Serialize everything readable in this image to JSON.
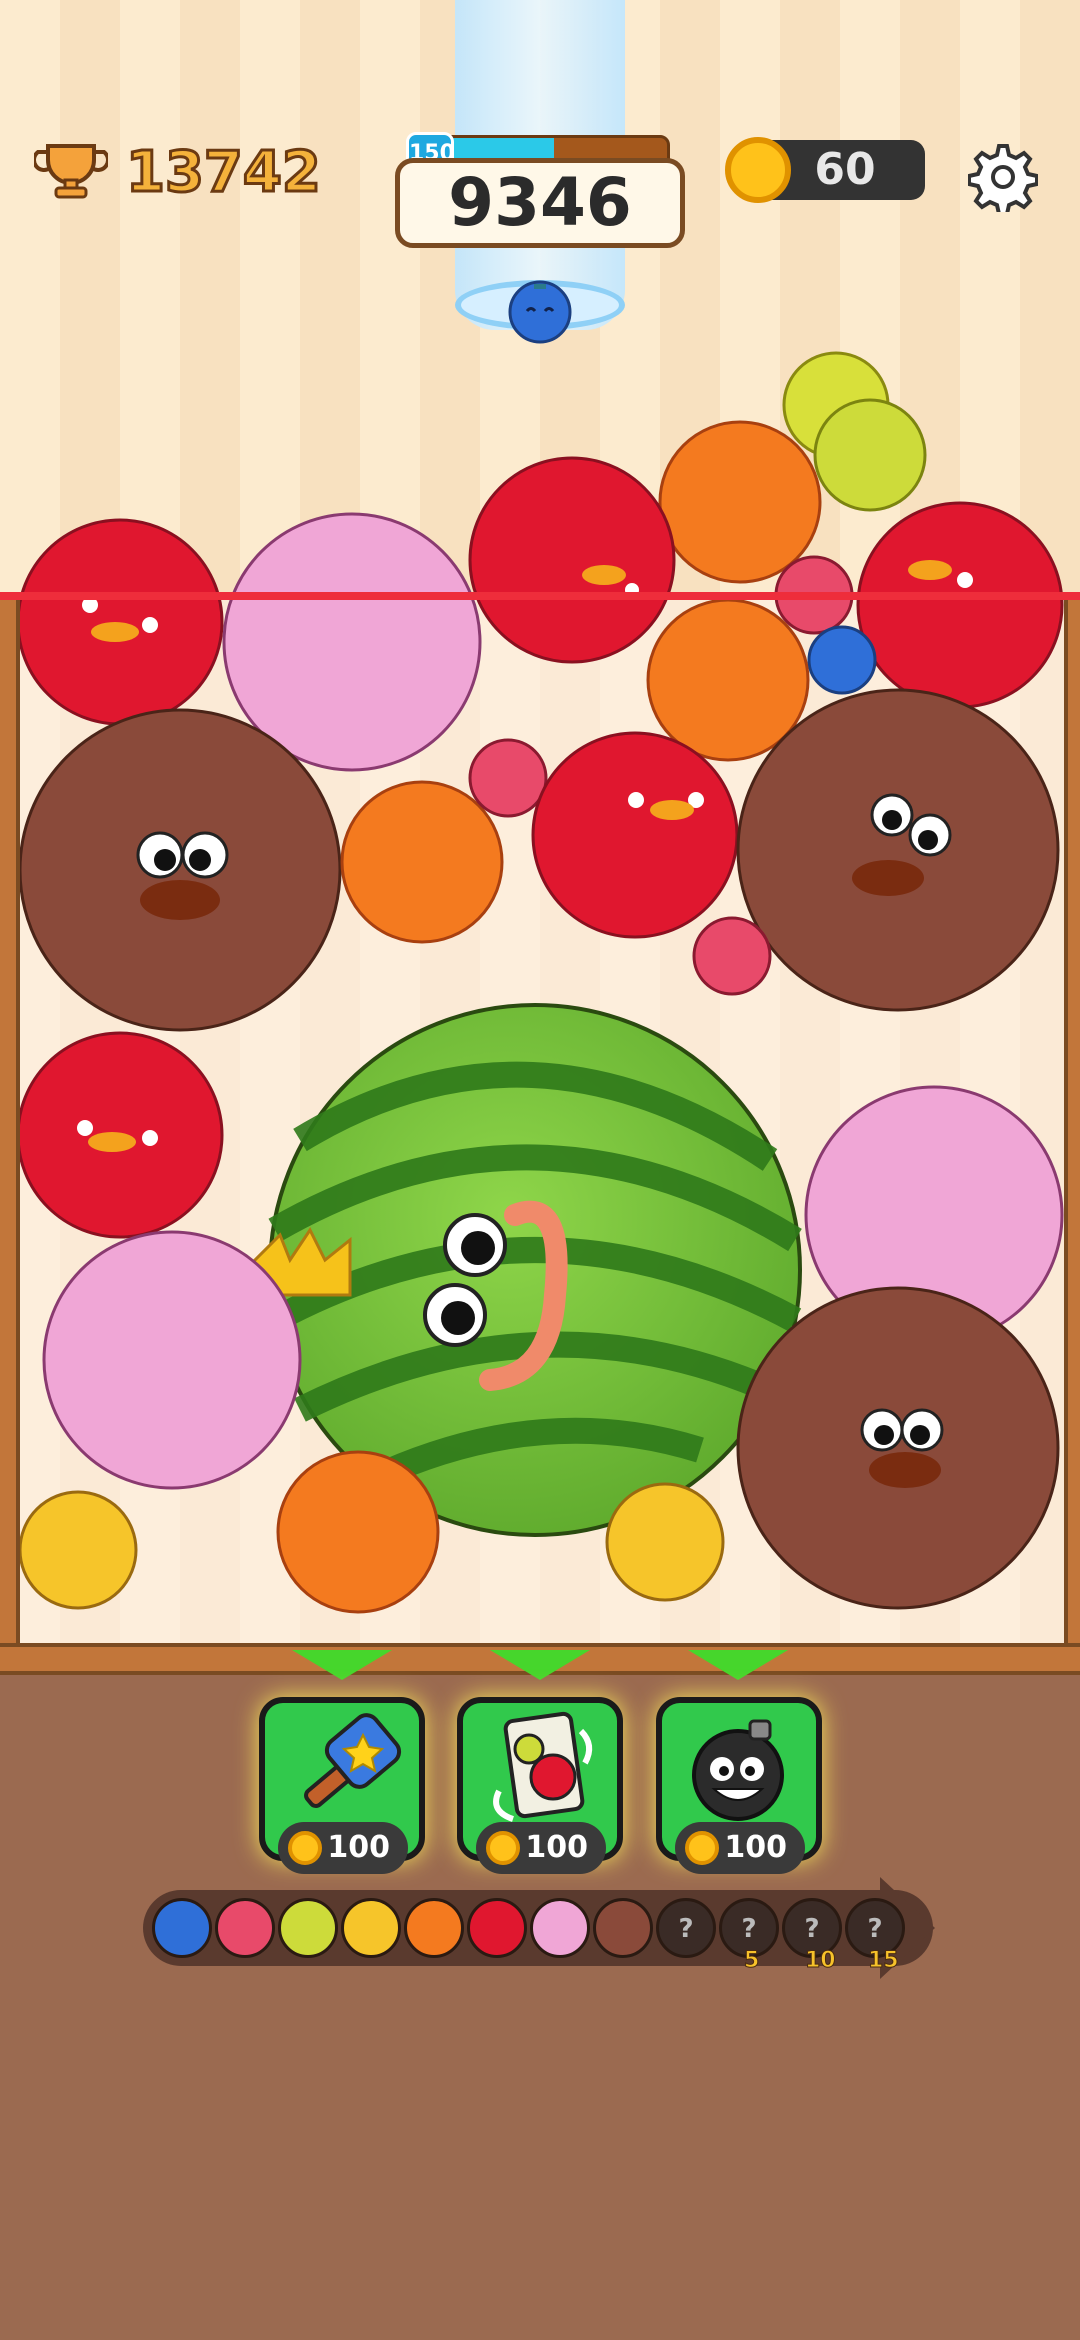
{
  "hud": {
    "best_score": "13742",
    "score": "9346",
    "level": "150",
    "level_progress": 0.55,
    "coins": "60"
  },
  "icons": {
    "trophy": "trophy-icon",
    "coin": "coin-icon",
    "settings": "gear-icon"
  },
  "next_fruit": "blueberry",
  "board_fruits": [
    {
      "kind": "apple"
    },
    {
      "kind": "peach"
    },
    {
      "kind": "apple"
    },
    {
      "kind": "orange"
    },
    {
      "kind": "lemon"
    },
    {
      "kind": "pear"
    },
    {
      "kind": "apple"
    },
    {
      "kind": "strawberry"
    },
    {
      "kind": "blueberry"
    },
    {
      "kind": "orange"
    },
    {
      "kind": "coconut"
    },
    {
      "kind": "orange"
    },
    {
      "kind": "strawberry"
    },
    {
      "kind": "apple"
    },
    {
      "kind": "coconut"
    },
    {
      "kind": "strawberry"
    },
    {
      "kind": "apple"
    },
    {
      "kind": "watermelon"
    },
    {
      "kind": "peach"
    },
    {
      "kind": "peach"
    },
    {
      "kind": "coconut"
    },
    {
      "kind": "orange"
    },
    {
      "kind": "grapes"
    },
    {
      "kind": "grapes"
    }
  ],
  "powerups": [
    {
      "name": "hammer",
      "price": "100"
    },
    {
      "name": "swap-card",
      "price": "100"
    },
    {
      "name": "bomb",
      "price": "100"
    }
  ],
  "evolution": [
    {
      "kind": "blueberry"
    },
    {
      "kind": "strawberry"
    },
    {
      "kind": "lemon"
    },
    {
      "kind": "grapes"
    },
    {
      "kind": "orange"
    },
    {
      "kind": "apple"
    },
    {
      "kind": "peach"
    },
    {
      "kind": "coconut"
    },
    {
      "kind": "locked",
      "label": "?"
    },
    {
      "kind": "locked",
      "label": "?",
      "reward": "5"
    },
    {
      "kind": "locked",
      "label": "?",
      "reward": "10"
    },
    {
      "kind": "locked",
      "label": "?",
      "reward": "15"
    }
  ]
}
